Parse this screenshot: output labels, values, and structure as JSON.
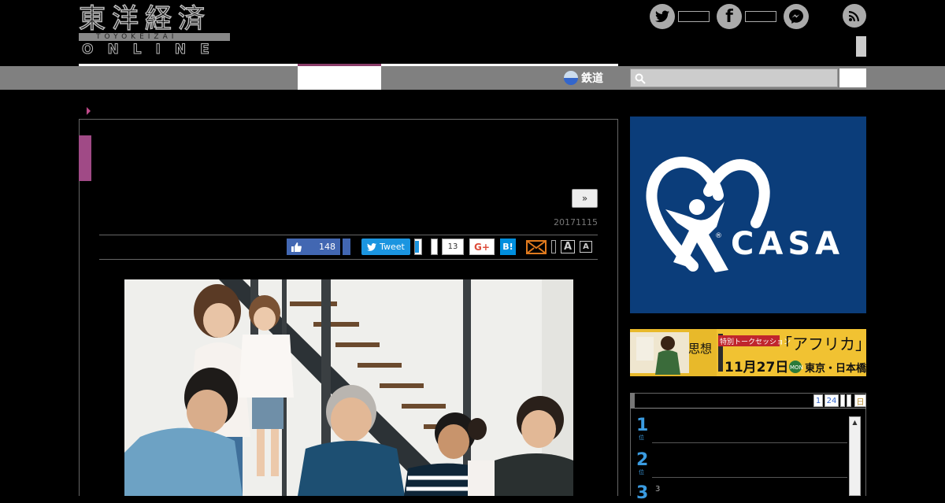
{
  "header": {
    "logo": {
      "kanji": "東洋経済",
      "roman": "TOYOKEIZAI",
      "online": "ONLINE"
    },
    "social": [
      {
        "name": "twitter-icon",
        "glyph": ""
      },
      {
        "name": "facebook-icon",
        "glyph": "f"
      },
      {
        "name": "messenger-icon",
        "glyph": ""
      },
      {
        "name": "rss-icon",
        "glyph": ""
      }
    ]
  },
  "nav": {
    "rail_label": "鉄道",
    "search": {
      "placeholder": ""
    }
  },
  "article": {
    "next_label": "»",
    "date": "20171115",
    "share": {
      "tweet_label": "Tweet",
      "facebook_count": "148",
      "pocket_count": "13",
      "gplus_label": "G+",
      "hatena_label": "B!",
      "font_large": "A",
      "font_small": "A"
    }
  },
  "sidebar": {
    "ad1": {
      "brand": "CASA",
      "registered": "®"
    },
    "ad2": {
      "left_text": "思想",
      "session_label": "特別トークセッション",
      "title": "「アフリカ」",
      "date": "11月27日",
      "day": "MON",
      "venue": "東京・日本橋"
    },
    "ranking": {
      "tabs": [
        "1",
        "24",
        "",
        "",
        "日"
      ],
      "items": [
        {
          "rank": "1",
          "unit": "位",
          "sub": ""
        },
        {
          "rank": "2",
          "unit": "位",
          "sub": ""
        },
        {
          "rank": "3",
          "unit": "",
          "sub": "3"
        }
      ]
    }
  }
}
